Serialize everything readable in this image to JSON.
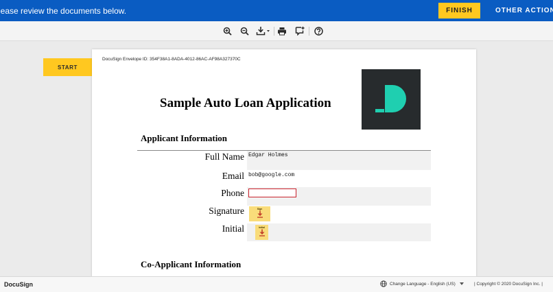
{
  "topbar": {
    "message": "lease review the documents below.",
    "finish_label": "FINISH",
    "other_actions_label": "OTHER ACTIONS"
  },
  "toolbar": {
    "tools": [
      "zoom-in-icon",
      "zoom-out-icon",
      "download-icon",
      "print-icon",
      "comment-icon",
      "help-icon"
    ]
  },
  "sidebar": {
    "start_label": "START"
  },
  "document": {
    "envelope_id": "DocuSign Envelope ID: 354F38A1-8ADA-4012-86AC-AF98A327370C",
    "title": "Sample Auto Loan Application",
    "applicant_section": "Applicant Information",
    "coapplicant_section": "Co-Applicant Information",
    "fields": {
      "full_name_label": "Full Name",
      "full_name_value": "Edgar Holmes",
      "email_label": "Email",
      "email_value": "bob@google.com",
      "phone_label": "Phone",
      "phone_value": "",
      "signature_label": "Signature",
      "signature_tag": "Sign",
      "initial_label": "Initial",
      "initial_tag": "Initial"
    }
  },
  "footer": {
    "brand": "DocuSign",
    "language": "Change Language - English (US)",
    "copyright": "|   Copyright © 2020 DocuSign Inc. |"
  },
  "colors": {
    "topbar_bg": "#0a5cc2",
    "accent_yellow": "#ffc820",
    "logo_bg": "#272b2d",
    "logo_teal": "#1fcfb0",
    "required_red": "#c8202b"
  }
}
